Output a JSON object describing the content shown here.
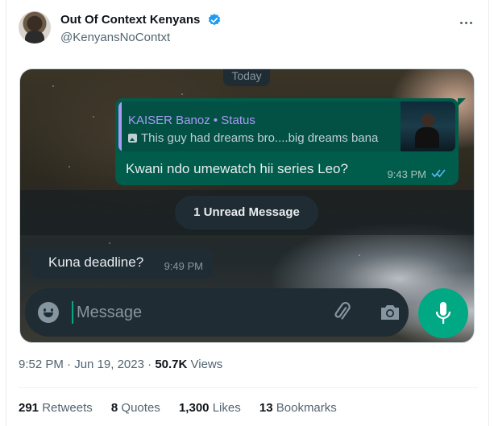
{
  "tweet": {
    "display_name": "Out Of Context Kenyans",
    "handle": "@KenyansNoContxt",
    "verified_color": "#1d9bf0",
    "time": "9:52 PM",
    "date": "Jun 19, 2023",
    "views_count": "50.7K",
    "views_label": "Views",
    "stats": {
      "retweets_count": "291",
      "retweets_label": "Retweets",
      "quotes_count": "8",
      "quotes_label": "Quotes",
      "likes_count": "1,300",
      "likes_label": "Likes",
      "bookmarks_count": "13",
      "bookmarks_label": "Bookmarks"
    }
  },
  "chat": {
    "date_chip": "Today",
    "outgoing": {
      "quote_title": "KAISER Banoz • Status",
      "quote_text": "This guy had dreams bro....big dreams bana",
      "text": "Kwani ndo umewatch hii series Leo?",
      "time": "9:43 PM",
      "tick_color": "#53bdeb"
    },
    "unread_label": "1 Unread Message",
    "incoming": {
      "text": "Kuna deadline?",
      "time": "9:49 PM"
    },
    "compose": {
      "placeholder": "Message"
    },
    "icons": [
      "emoji-icon",
      "attach-icon",
      "camera-icon",
      "mic-icon",
      "double-tick-icon",
      "verified-icon",
      "more-icon"
    ]
  }
}
